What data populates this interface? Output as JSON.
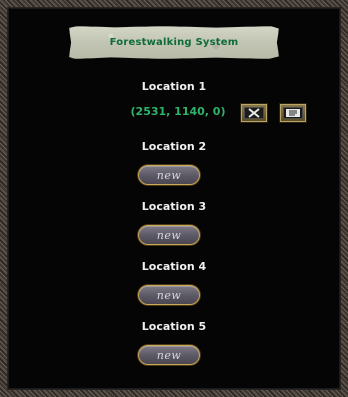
{
  "window": {
    "title": "Forestwalking System"
  },
  "locations": [
    {
      "label": "Location 1",
      "coords": "(2531, 1140, 0)"
    },
    {
      "label": "Location 2",
      "button": "new"
    },
    {
      "label": "Location 3",
      "button": "new"
    },
    {
      "label": "Location 4",
      "button": "new"
    },
    {
      "label": "Location 5",
      "button": "new"
    }
  ],
  "actions": {
    "delete_icon": "close-icon",
    "goto_icon": "scroll-icon"
  },
  "colors": {
    "title_text": "#0e6b3a",
    "coords_text": "#2fb36a",
    "label_text": "#f0f0f0"
  }
}
